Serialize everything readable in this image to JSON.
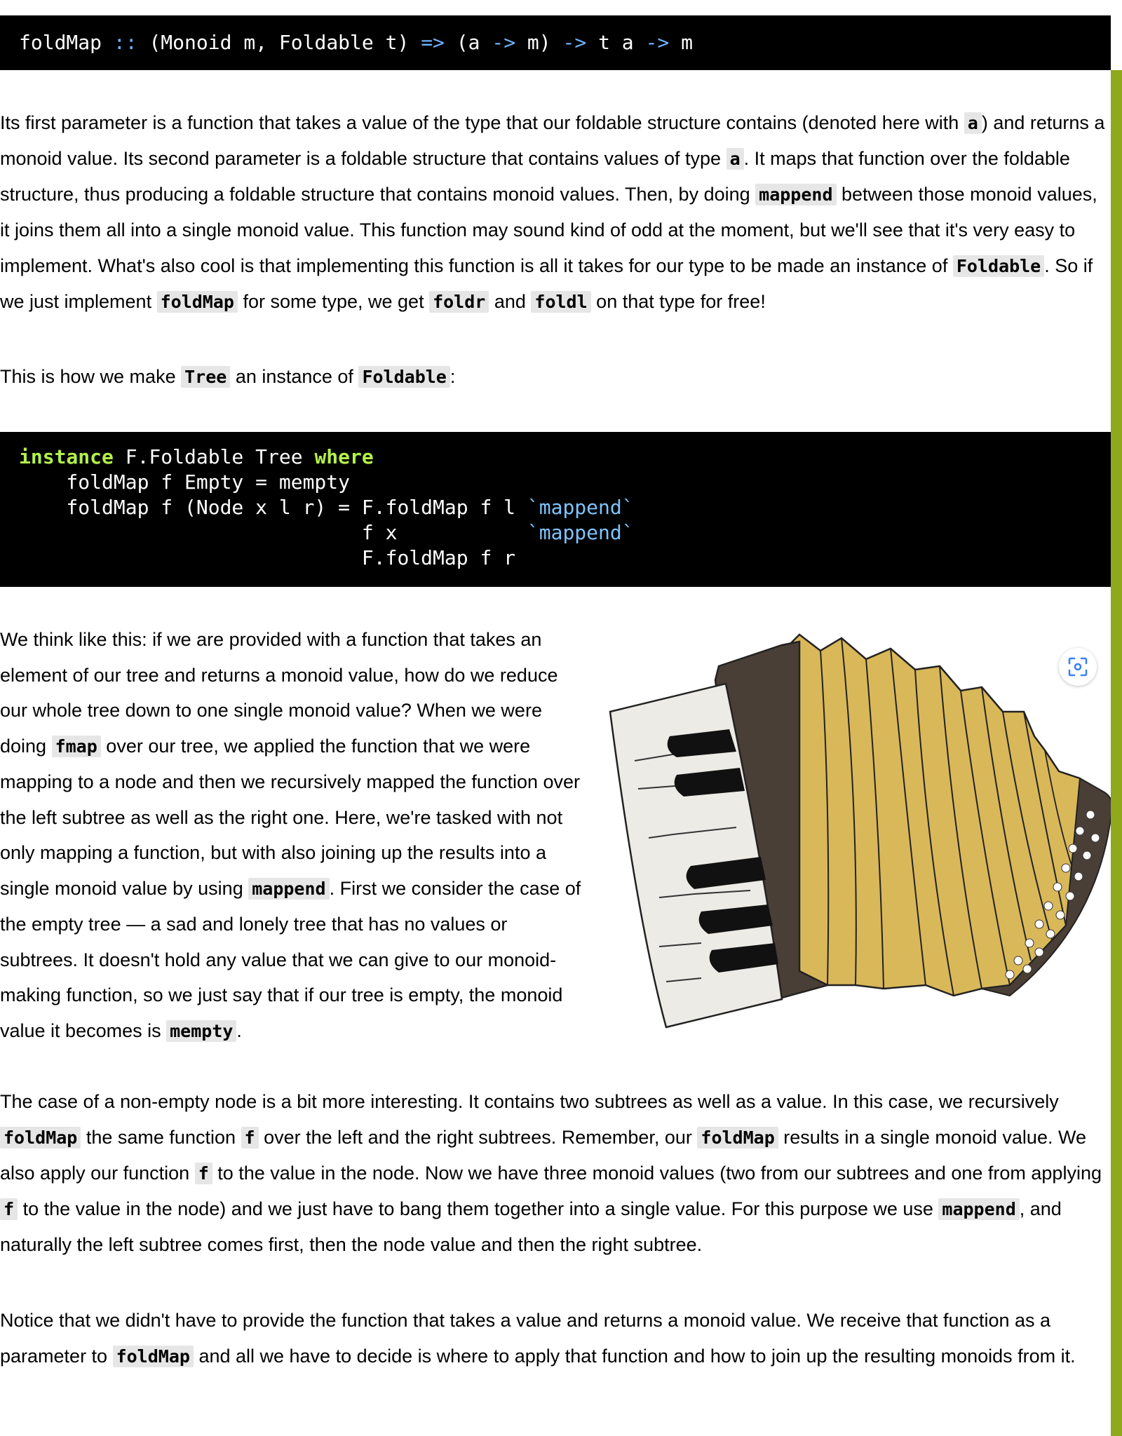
{
  "signature": {
    "name": "foldMap",
    "dcolon": "::",
    "constraints": "(Monoid m, Foldable t)",
    "arrow1": "=>",
    "arg1": "(a",
    "arrow2": "->",
    "arg1_end": "m)",
    "arrow3": "->",
    "arg2": "t a",
    "arrow4": "->",
    "result": "m"
  },
  "para1": {
    "t1": "Its first parameter is a function that takes a value of the type that our foldable structure contains (denoted here with ",
    "c1": "a",
    "t2": ") and returns a monoid value. Its second parameter is a foldable structure that contains values of type ",
    "c2": "a",
    "t3": ". It maps that function over the foldable structure, thus producing a foldable structure that contains monoid values. Then, by doing ",
    "c3": "mappend",
    "t4": " between those monoid values, it joins them all into a single monoid value. This function may sound kind of odd at the moment, but we'll see that it's very easy to implement. What's also cool is that implementing this function is all it takes for our type to be made an instance of ",
    "c4": "Foldable",
    "t5": ". So if we just implement ",
    "c5": "foldMap",
    "t6": " for some type, we get ",
    "c6": "foldr",
    "t7": " and ",
    "c7": "foldl",
    "t8": " on that type for free!"
  },
  "para2": {
    "t1": "This is how we make ",
    "c1": "Tree",
    "t2": " an instance of ",
    "c2": "Foldable",
    "t3": ":"
  },
  "code": {
    "l1_kw1": "instance",
    "l1_mid": " F.Foldable Tree ",
    "l1_kw2": "where",
    "l2": "    foldMap f Empty = mempty",
    "l3": "    foldMap f (Node x l r) = F.foldMap f l ",
    "l3_bt": "`mappend`",
    "l4": "                             f x           ",
    "l4_bt": "`mappend`",
    "l5": "                             F.foldMap f r"
  },
  "para3": {
    "t1": "We think like this: if we are provided with a function that takes an element of our tree and returns a monoid value, how do we reduce our whole tree down to one single monoid value? When we were doing ",
    "c1": "fmap",
    "t2": " over our tree, we applied the function that we were mapping to a node and then we recursively mapped the function over the left subtree as well as the right one. Here, we're tasked with not only mapping a function, but with also joining up the results into a single monoid value by using ",
    "c2": "mappend",
    "t3": ". First we consider the case of the empty tree — a sad and lonely tree that has no values or subtrees. It doesn't hold any value that we can give to our monoid-making function, so we just say that if our tree is empty, the monoid value it becomes is ",
    "c3": "mempty",
    "t4": "."
  },
  "para4": {
    "t1": "The case of a non-empty node is a bit more interesting. It contains two subtrees as well as a value. In this case, we recursively ",
    "c1": "foldMap",
    "t2": " the same function ",
    "c2": "f",
    "t3": " over the left and the right subtrees. Remember, our ",
    "c3": "foldMap",
    "t4": " results in a single monoid value. We also apply our function ",
    "c4": "f",
    "t5": " to the value in the node. Now we have three monoid values (two from our subtrees and one from applying ",
    "c5": "f",
    "t6": " to the value in the node) and we just have to bang them together into a single value. For this purpose we use ",
    "c6": "mappend",
    "t7": ", and naturally the left subtree comes first, then the node value and then the right subtree."
  },
  "para5": {
    "t1": "Notice that we didn't have to provide the function that takes a value and returns a monoid value. We receive that function as a parameter to ",
    "c1": "foldMap",
    "t2": " and all we have to decide is where to apply that function and how to join up the resulting monoids from it."
  },
  "icons": {
    "illustration": "accordion-illustration",
    "expand": "image-expand-icon"
  },
  "colors": {
    "code_bg": "#000000",
    "keyword": "#b3f04a",
    "operator": "#6fb3ff",
    "inline_code_bg": "#e6e6e6",
    "accent_bar": "#8fa81c",
    "bellows": "#d9b85a",
    "frame": "#4a3f36"
  }
}
